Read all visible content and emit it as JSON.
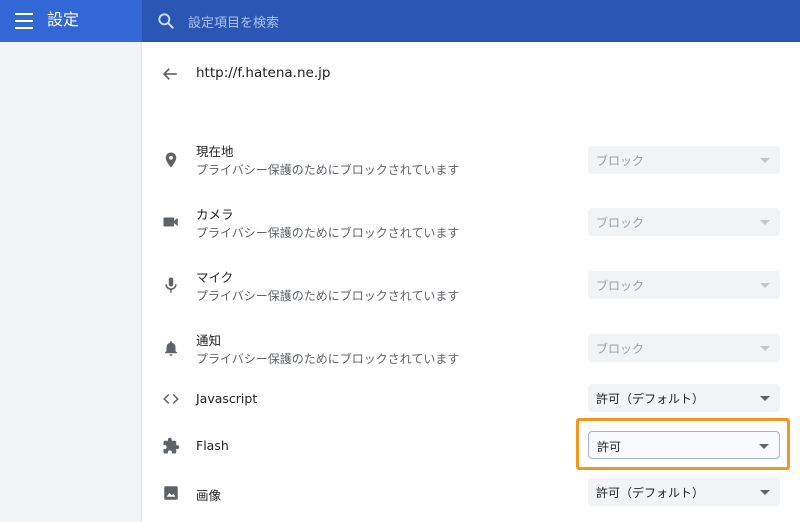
{
  "header": {
    "title": "設定",
    "search_placeholder": "設定項目を検索"
  },
  "page": {
    "url": "http://f.hatena.ne.jp"
  },
  "permissions": [
    {
      "title": "現在地",
      "subtitle": "プライバシー保護のためにブロックされています",
      "value": "ブロック",
      "icon": "location-icon",
      "state": "disabled"
    },
    {
      "title": "カメラ",
      "subtitle": "プライバシー保護のためにブロックされています",
      "value": "ブロック",
      "icon": "camera-icon",
      "state": "disabled"
    },
    {
      "title": "マイク",
      "subtitle": "プライバシー保護のためにブロックされています",
      "value": "ブロック",
      "icon": "microphone-icon",
      "state": "disabled"
    },
    {
      "title": "通知",
      "subtitle": "プライバシー保護のためにブロックされています",
      "value": "ブロック",
      "icon": "bell-icon",
      "state": "disabled"
    },
    {
      "title": "Javascript",
      "value": "許可（デフォルト）",
      "icon": "code-icon",
      "state": "enabled"
    },
    {
      "title": "Flash",
      "value": "許可",
      "icon": "puzzle-icon",
      "state": "focused"
    },
    {
      "title": "画像",
      "value": "許可（デフォルト）",
      "icon": "image-icon",
      "state": "enabled"
    }
  ],
  "colors": {
    "header_bg": "#3367d6",
    "search_bg": "#2a56b4",
    "highlight": "#f7941d"
  }
}
